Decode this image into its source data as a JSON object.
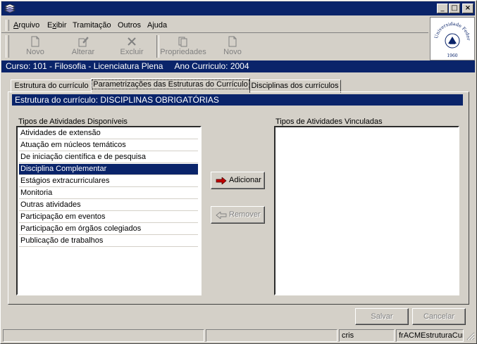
{
  "window": {
    "title": "",
    "controls": {
      "minimize": "_",
      "maximize": "□",
      "close": "×"
    }
  },
  "menu": {
    "items": [
      "Arquivo",
      "Exibir",
      "Tramitação",
      "Outros",
      "Ajuda"
    ],
    "mnemonics": [
      "A",
      "x",
      "",
      "",
      "j"
    ]
  },
  "toolbar": {
    "buttons": [
      {
        "label": "Novo",
        "icon": "new-document-icon",
        "enabled": false
      },
      {
        "label": "Alterar",
        "icon": "edit-document-icon",
        "enabled": false
      },
      {
        "label": "Excluir",
        "icon": "delete-x-icon",
        "enabled": false
      },
      {
        "label": "Propriedades",
        "icon": "properties-icon",
        "enabled": false
      },
      {
        "label": "Novo",
        "icon": "new-document-icon",
        "enabled": false
      }
    ]
  },
  "logo": {
    "text": "Universidade Federal de Santa Maria",
    "year": "1960"
  },
  "course_bar": {
    "course": "Curso: 101 - Filosofia - Licenciatura Plena",
    "year": "Ano Curriculo: 2004"
  },
  "tabs": [
    {
      "label": "Estrutura do currículo",
      "active": false
    },
    {
      "label": "Parametrizações das Estruturas do Currículo",
      "active": true
    },
    {
      "label": "Disciplinas dos currículos",
      "active": false
    }
  ],
  "panel": {
    "header": "Estrutura do currículo: DISCIPLINAS OBRIGATÓRIAS",
    "available_label": "Tipos de Atividades Disponíveis",
    "linked_label": "Tipos de Atividades Vinculadas",
    "available_items": [
      "Atividades de extensão",
      "Atuação em núcleos temáticos",
      "De iniciação científica e de pesquisa",
      "Disciplina Complementar",
      "Estágios extracurriculares",
      "Monitoria",
      "Outras atividades",
      "Participação em eventos",
      "Participação em órgãos colegiados",
      "Publicação de trabalhos"
    ],
    "selected_item": "Disciplina Complementar",
    "linked_items": [],
    "add_label": "Adicionar",
    "remove_label": "Remover"
  },
  "actions": {
    "save_label": "Salvar",
    "cancel_label": "Cancelar"
  },
  "status": {
    "panel1": "",
    "panel2": "",
    "user": "cris",
    "form": "frACMEstruturaCurr"
  },
  "colors": {
    "title_blue": "#0a246a",
    "face": "#d4d0c8",
    "arrow_red": "#c00000"
  }
}
